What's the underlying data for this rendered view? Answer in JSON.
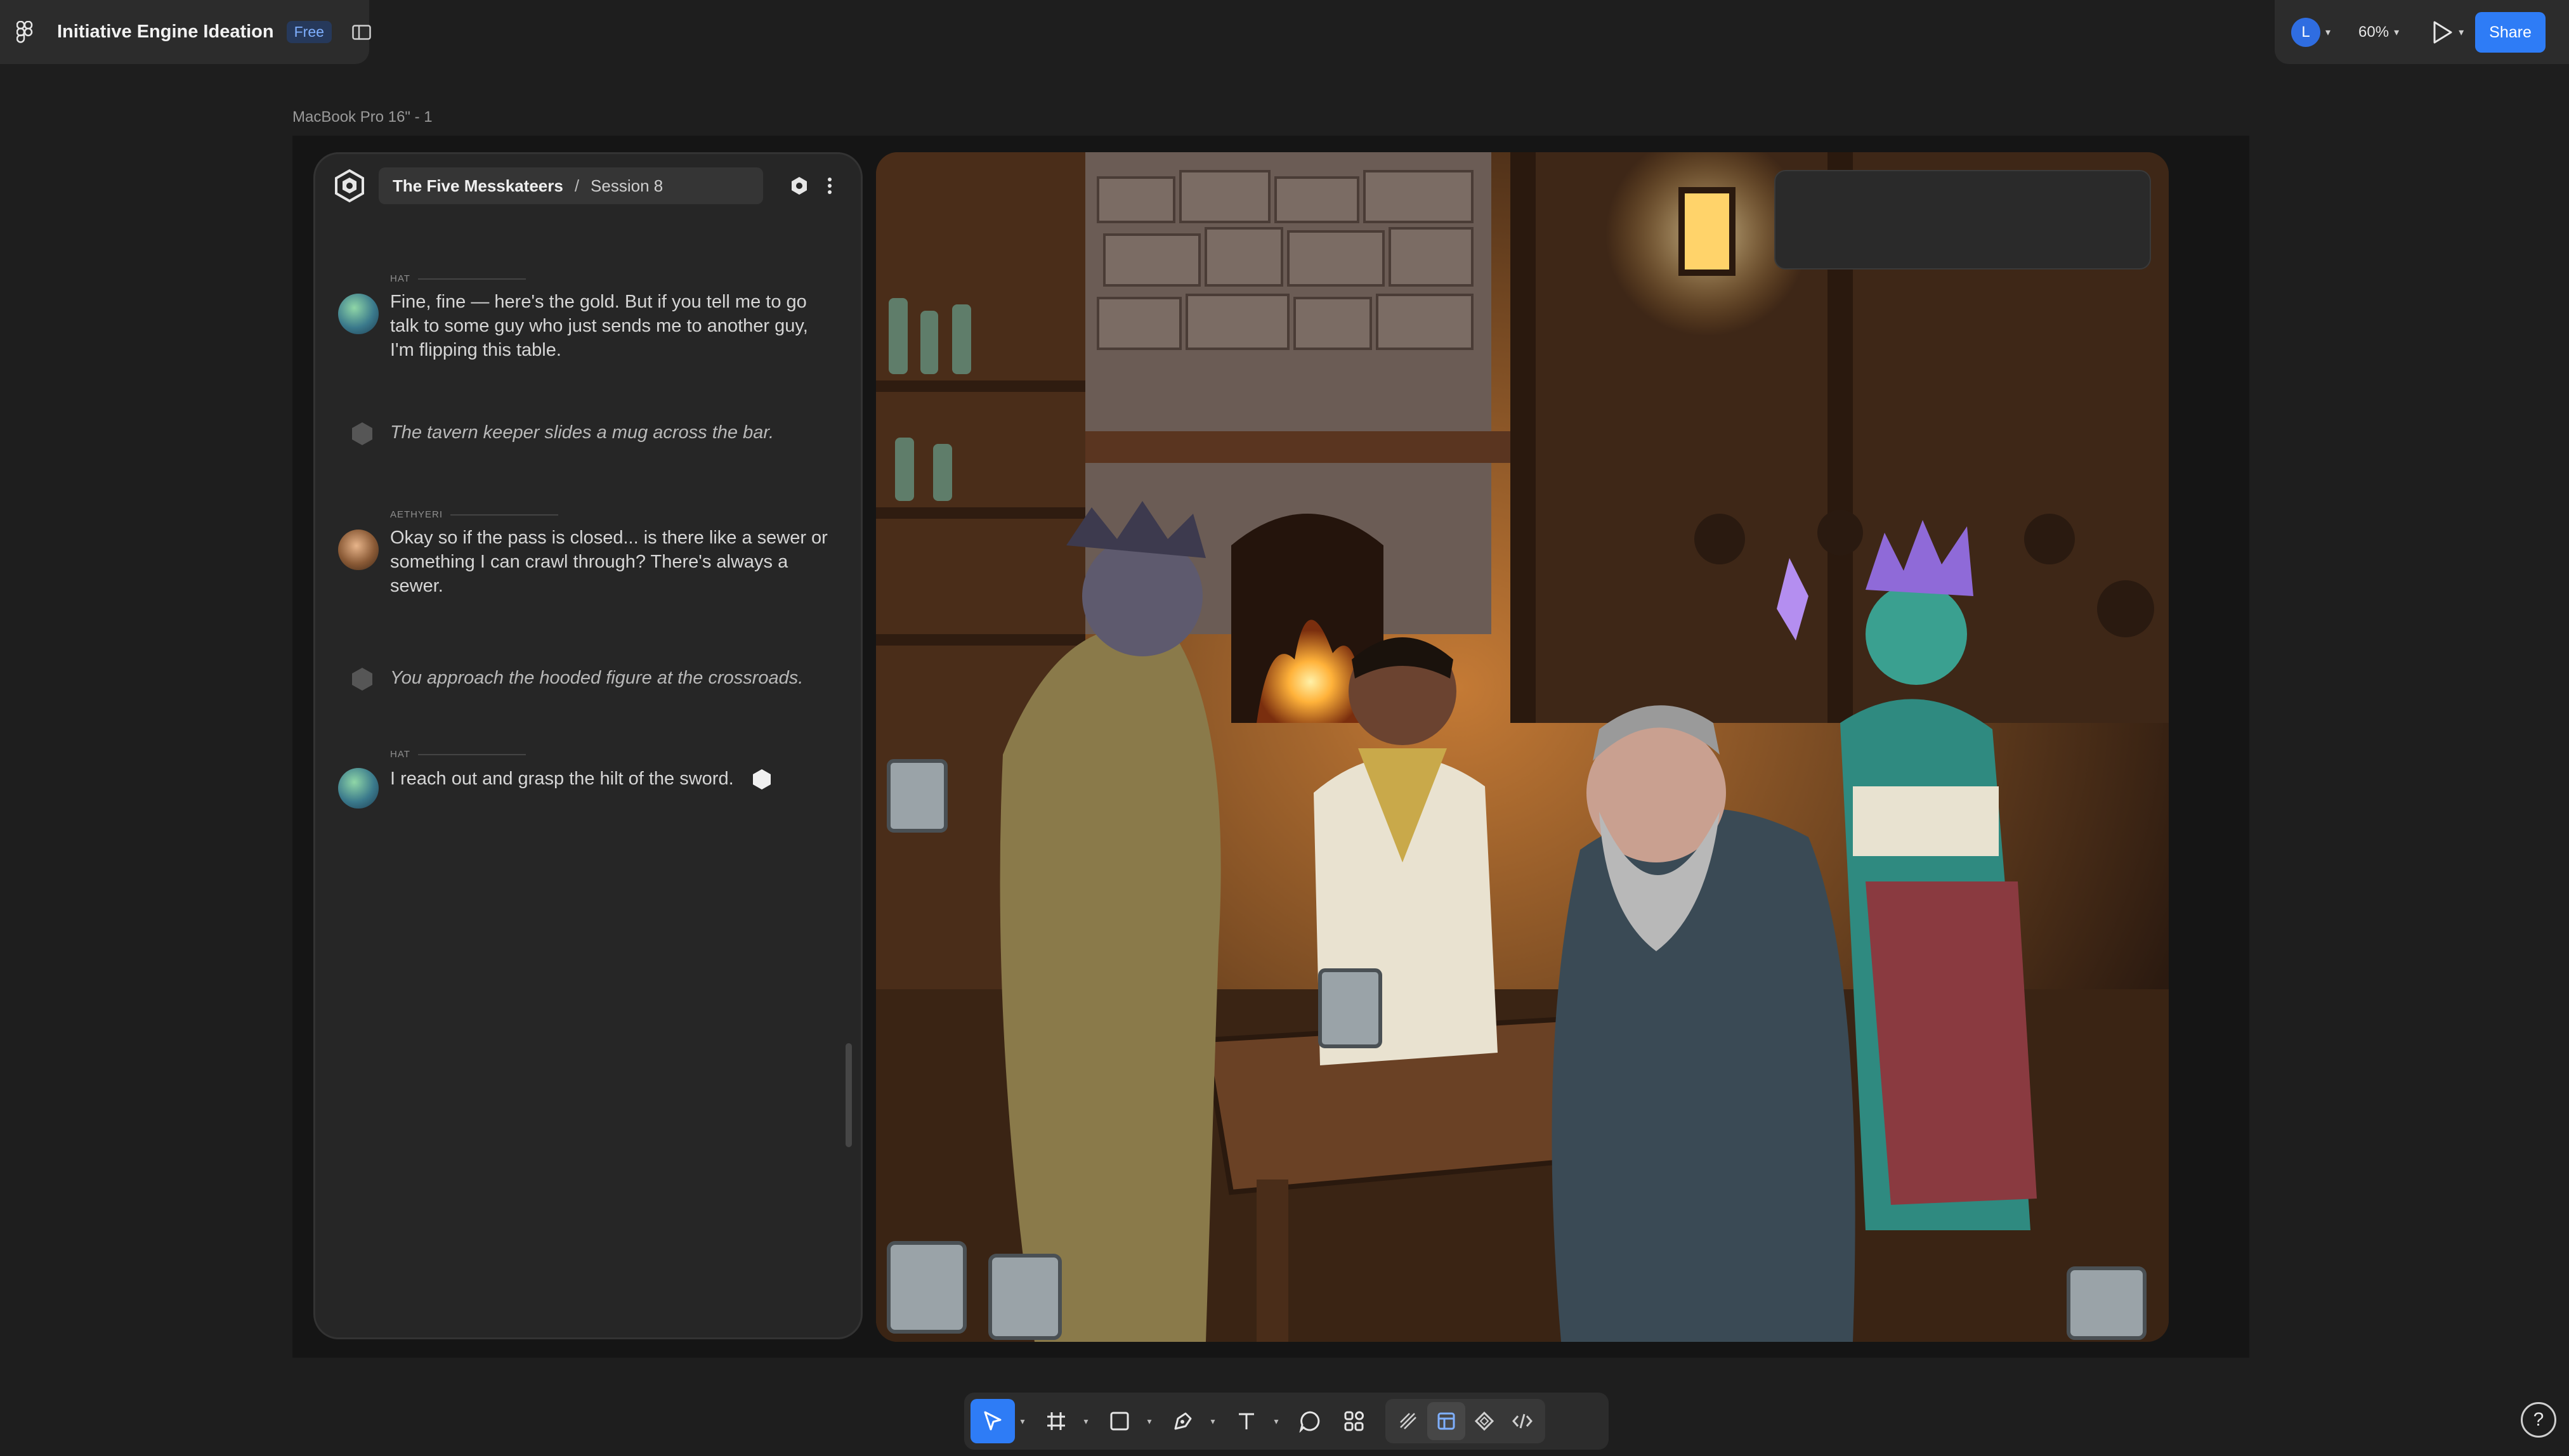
{
  "app": {
    "file_title": "Initiative Engine Ideation",
    "plan_badge": "Free",
    "user_initial": "L",
    "zoom": "60%",
    "share_label": "Share",
    "frame_label": "MacBook Pro 16\" - 1"
  },
  "chat": {
    "campaign": "The Five Messkateers",
    "separator": "/",
    "session": "Session 8",
    "messages": [
      {
        "type": "player",
        "speaker": "HAT",
        "text": "Fine, fine — here's the gold. But if you tell me to go talk to some guy who just sends me to another guy, I'm flipping this table."
      },
      {
        "type": "narration",
        "text": "The tavern keeper slides a mug across the bar."
      },
      {
        "type": "player",
        "speaker": "AETHYERI",
        "text": "Okay so if the pass is closed... is there like a sewer or something I can crawl through? There's always a sewer."
      },
      {
        "type": "narration",
        "text": "You approach the hooded figure at the crossroads."
      },
      {
        "type": "player",
        "speaker": "HAT",
        "text": "I reach out and grasp the hilt of the sword."
      }
    ]
  },
  "icons": {
    "app_menu": "figma-logo-icon",
    "panel": "sidebar-toggle-icon",
    "play": "play-icon",
    "help": "?"
  },
  "colors": {
    "accent": "#2e7cf6",
    "badge_bg": "#26395b",
    "badge_text": "#7fb0ff",
    "canvas_bg": "#1e1e1e",
    "panel_bg": "#262626"
  }
}
